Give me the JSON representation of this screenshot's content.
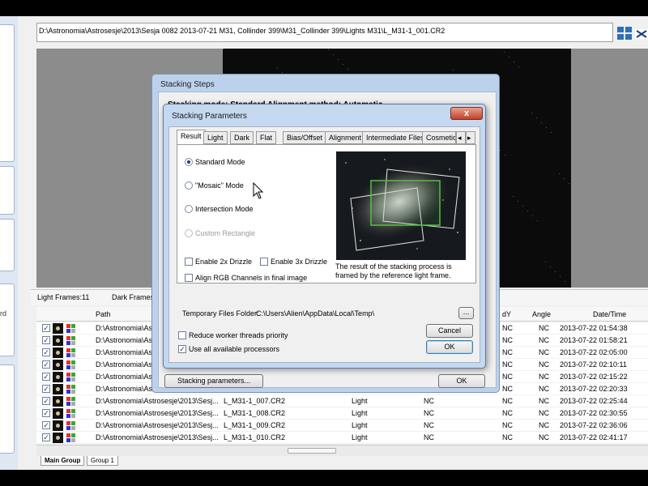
{
  "path": "D:\\Astronomia\\Astrosesje\\2013\\Sesja 0082 2013-07-21 M31, Collinder 399\\M31_Collinder 399\\Lights M31\\L_M31-1_001.CR2",
  "sidebar": {
    "label_fragment": "rd"
  },
  "frames_header": {
    "light_frames": "Light Frames:11",
    "dark_frames": "Dark Frames"
  },
  "columns": {
    "path": "Path",
    "dy": "dY",
    "angle": "Angle",
    "datetime": "Date/Time"
  },
  "rows": [
    {
      "path": "D:\\Astronomia\\As",
      "file": "",
      "type": "",
      "dx": "",
      "dy": "NC",
      "angle": "NC",
      "datetime": "2013-07-22 01:54:38"
    },
    {
      "path": "D:\\Astronomia\\As",
      "file": "",
      "type": "",
      "dx": "",
      "dy": "NC",
      "angle": "NC",
      "datetime": "2013-07-22 01:58:21"
    },
    {
      "path": "D:\\Astronomia\\As",
      "file": "",
      "type": "",
      "dx": "",
      "dy": "NC",
      "angle": "NC",
      "datetime": "2013-07-22 02:05:00"
    },
    {
      "path": "D:\\Astronomia\\As",
      "file": "",
      "type": "",
      "dx": "",
      "dy": "NC",
      "angle": "NC",
      "datetime": "2013-07-22 02:10:11"
    },
    {
      "path": "D:\\Astronomia\\As",
      "file": "",
      "type": "",
      "dx": "",
      "dy": "NC",
      "angle": "NC",
      "datetime": "2013-07-22 02:15:22"
    },
    {
      "path": "D:\\Astronomia\\As",
      "file": "",
      "type": "",
      "dx": "",
      "dy": "NC",
      "angle": "NC",
      "datetime": "2013-07-22 02:20:33"
    },
    {
      "path": "D:\\Astronomia\\Astrosesje\\2013\\Sesj...",
      "file": "L_M31-1_007.CR2",
      "type": "Light",
      "dx": "NC",
      "dy": "NC",
      "angle": "NC",
      "datetime": "2013-07-22 02:25:44"
    },
    {
      "path": "D:\\Astronomia\\Astrosesje\\2013\\Sesj...",
      "file": "L_M31-1_008.CR2",
      "type": "Light",
      "dx": "NC",
      "dy": "NC",
      "angle": "NC",
      "datetime": "2013-07-22 02:30:55"
    },
    {
      "path": "D:\\Astronomia\\Astrosesje\\2013\\Sesj...",
      "file": "L_M31-1_009.CR2",
      "type": "Light",
      "dx": "NC",
      "dy": "NC",
      "angle": "NC",
      "datetime": "2013-07-22 02:36:06"
    },
    {
      "path": "D:\\Astronomia\\Astrosesje\\2013\\Sesj...",
      "file": "L_M31-1_010.CR2",
      "type": "Light",
      "dx": "NC",
      "dy": "NC",
      "angle": "NC",
      "datetime": "2013-07-22 02:41:17"
    }
  ],
  "bottom_tabs": [
    "Main Group",
    "Group 1"
  ],
  "steps_dialog": {
    "title": "Stacking Steps",
    "line1": "Stacking mode: Standard                    Alignment method: Automatic",
    "params_button": "Stacking parameters...",
    "ok": "OK"
  },
  "params_dialog": {
    "title": "Stacking Parameters",
    "close": "x",
    "tabs": [
      "Result",
      "Light",
      "Dark",
      "Flat",
      "Bias/Offset",
      "Alignment",
      "Intermediate Files",
      "Cosmetic"
    ],
    "tab_scroll_left": "◂",
    "tab_scroll_right": "▸",
    "modes": [
      {
        "label": "Standard Mode",
        "selected": true,
        "enabled": true
      },
      {
        "label": "\"Mosaic\" Mode",
        "selected": false,
        "enabled": true
      },
      {
        "label": "Intersection Mode",
        "selected": false,
        "enabled": true
      },
      {
        "label": "Custom Rectangle",
        "selected": false,
        "enabled": false
      }
    ],
    "drizzle2x": "Enable 2x Drizzle",
    "drizzle3x": "Enable 3x Drizzle",
    "align_rgb": "Align RGB Channels in final image",
    "caption": "The result of the stacking process is framed by the reference light frame.",
    "temp_label": "Temporary Files Folder:",
    "temp_value": "C:\\Users\\Alien\\AppData\\Local\\Temp\\",
    "browse": "...",
    "reduce_threads": "Reduce worker threads priority",
    "use_all_processors": "Use all available processors",
    "use_all_checked": true,
    "cancel": "Cancel",
    "ok": "OK"
  },
  "colors": {
    "title_bar": "#c4d8ef",
    "ok_default_border": "#3c7fb1",
    "close_red": "#c2412b"
  }
}
